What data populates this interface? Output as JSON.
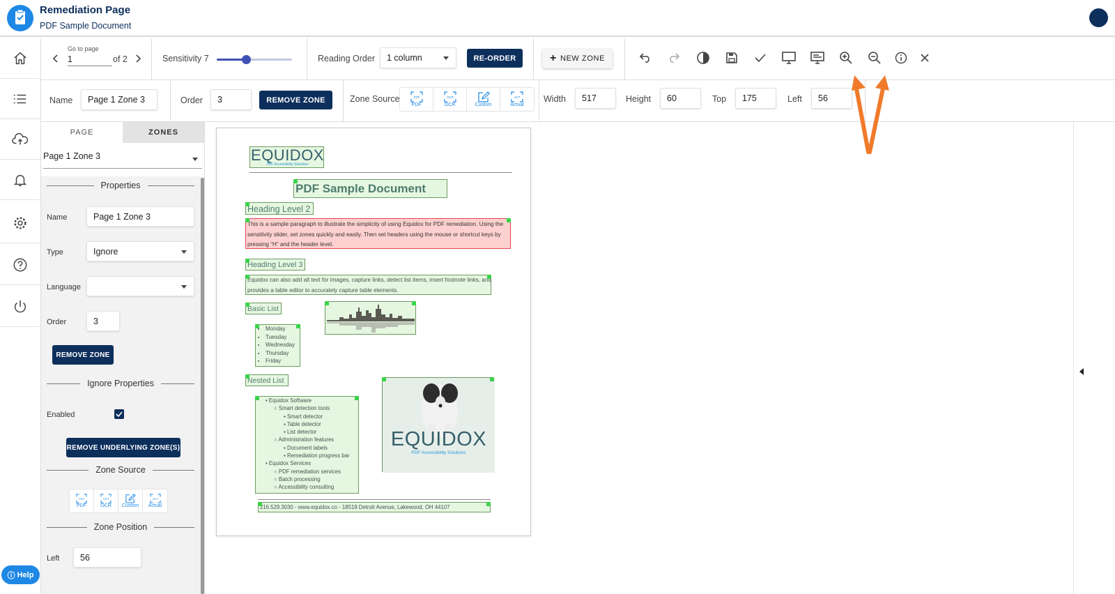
{
  "header": {
    "title": "Remediation Page",
    "subtitle": "PDF Sample Document"
  },
  "leftnav": {
    "items": [
      "home-icon",
      "list-icon",
      "cloud-upload-icon",
      "bell-icon",
      "gear-icon",
      "help-circle-icon",
      "power-icon"
    ],
    "help_label": "Help"
  },
  "toolbar": {
    "goto_label": "Go to page",
    "page_value": "1",
    "page_of": "of 2",
    "sensitivity_label": "Sensitivity 7",
    "sensitivity_level": 0.39,
    "reading_order_label": "Reading Order",
    "reading_order_value": "1 column",
    "reorder_label": "RE-ORDER",
    "new_zone_label": "NEW ZONE",
    "icons": [
      "undo-icon",
      "redo-icon",
      "contrast-icon",
      "save-icon",
      "check-icon",
      "monitor-icon",
      "presentation-icon",
      "zoom-in-icon",
      "zoom-out-icon",
      "info-icon",
      "close-icon"
    ]
  },
  "zone_bar": {
    "name_label": "Name",
    "name_value": "Page 1 Zone 3",
    "order_label": "Order",
    "order_value": "3",
    "remove_label": "REMOVE ZONE",
    "source_label": "Zone Source",
    "sources": [
      {
        "tag": "PDF",
        "label": "PDF"
      },
      {
        "tag": "OCR",
        "label": "OCR"
      },
      {
        "tag": "",
        "label": "Custom"
      },
      {
        "tag": "ACT",
        "label": "Actual"
      }
    ],
    "width_label": "Width",
    "width_value": "517",
    "height_label": "Height",
    "height_value": "60",
    "top_label": "Top",
    "top_value": "175",
    "left_label": "Left",
    "left_value": "56"
  },
  "panel": {
    "tabs": [
      "PAGE",
      "ZONES"
    ],
    "active_tab": "ZONES",
    "zone_select": "Page 1 Zone 3",
    "properties_title": "Properties",
    "name_label": "Name",
    "name_value": "Page 1 Zone 3",
    "type_label": "Type",
    "type_value": "Ignore",
    "language_label": "Language",
    "language_value": "",
    "order_label": "Order",
    "order_value": "3",
    "remove_label": "REMOVE ZONE",
    "ignore_title": "Ignore Properties",
    "enabled_label": "Enabled",
    "enabled": true,
    "remove_underlying_label": "REMOVE UNDERLYING ZONE(S)",
    "zone_source_title": "Zone Source",
    "zone_position_title": "Zone Position",
    "left_label": "Left",
    "left_value": "56"
  },
  "document": {
    "logo_text": "EQUIDOX",
    "logo_tagline": "PDF Accessibility Solutions",
    "title": "PDF Sample Document",
    "h2": "Heading Level 2",
    "para1": "This is a sample paragraph to illustrate the simplicity of using Equidox for PDF remediation. Using the sensitivity slider, set zones quickly and easily.  Then set headers using the mouse or shortcut keys by pressing “H” and the header level.",
    "h3": "Heading Level 3",
    "para2": "Equidox can also add alt text for images, capture links, detect list items, insert footnote links, and provides a table editor to accurately capture table elements.",
    "basic_list_title": "Basic List",
    "basic_list": [
      "Monday",
      "Tuesday",
      "Wednesday",
      "Thursday",
      "Friday"
    ],
    "nested_list_title": "Nested List",
    "nested": {
      "l1a": "Equidox Software",
      "l2a": "Smart detection tools",
      "l3a": [
        "Smart detector",
        "Table detector",
        "List detector"
      ],
      "l2b": "Administration features",
      "l3b": [
        "Document labels",
        "Remediation progress bar"
      ],
      "l1b": "Equidox Services",
      "l2c": [
        "PDF remediation services",
        "Batch processing",
        "Accessibility consulting"
      ]
    },
    "image_logo_text": "EQUIDOX",
    "image_tagline": "PDF Accessibility Solutions",
    "footer": "216.529.3030 - www.equidox.co - 18519 Detroit Avenue, Lakewood, OH 44107"
  },
  "colors": {
    "navy": "#0d2f5c",
    "accent_blue": "#1e88e5",
    "annotation_arrow": "#f07a2a",
    "zone_handle": "#3bd24a",
    "selected_zone": "#e0484e"
  }
}
